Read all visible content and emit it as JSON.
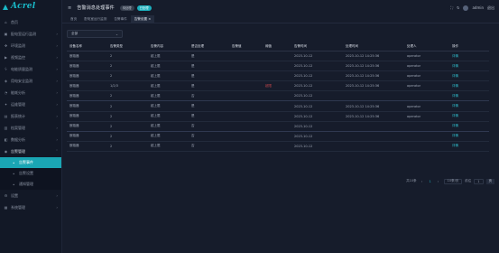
{
  "app": {
    "logo_text": "Acrel"
  },
  "sidebar": {
    "items": [
      {
        "label": "首页",
        "icon": "home-icon",
        "chevron": ""
      },
      {
        "label": "配电室运行监测",
        "icon": "monitor-icon",
        "chevron": "›"
      },
      {
        "label": "环境监测",
        "icon": "environment-icon",
        "chevron": "›"
      },
      {
        "label": "视频监控",
        "icon": "video-icon",
        "chevron": "›"
      },
      {
        "label": "电能质量监测",
        "icon": "power-quality-icon",
        "chevron": "›"
      },
      {
        "label": "用电安全监测",
        "icon": "shield-icon",
        "chevron": "›"
      },
      {
        "label": "能耗分析",
        "icon": "analysis-icon",
        "chevron": "›"
      },
      {
        "label": "运维管理",
        "icon": "maintenance-icon",
        "chevron": "›"
      },
      {
        "label": "报表统计",
        "icon": "report-icon",
        "chevron": "›"
      },
      {
        "label": "档案管理",
        "icon": "archive-icon",
        "chevron": "›"
      },
      {
        "label": "数据分析",
        "icon": "data-icon",
        "chevron": "›"
      },
      {
        "label": "告警管理",
        "icon": "alarm-icon",
        "chevron": "˄"
      }
    ],
    "sub_items": [
      {
        "label": "告警事件",
        "icon": "bell-icon",
        "active": true
      },
      {
        "label": "告警设置",
        "icon": "settings-icon",
        "active": false
      },
      {
        "label": "通知管理",
        "icon": "message-icon",
        "active": false
      }
    ],
    "bottom_items": [
      {
        "label": "设置",
        "icon": "gear-icon",
        "chevron": "›"
      },
      {
        "label": "系统管理",
        "icon": "system-icon",
        "chevron": "›"
      }
    ]
  },
  "topbar": {
    "menu_icon": "≡",
    "title": "告警消息处理事件",
    "badge_1": "待处理",
    "badge_2": "已处理",
    "right": {
      "fullscreen": "⛶",
      "refresh": "↻",
      "user": "admin",
      "logout": "退出"
    }
  },
  "tabs": [
    "首页",
    "配电室运行监测",
    "告警事件",
    "告警设置 ×"
  ],
  "filter": {
    "value": "全部",
    "chevron": "⌄"
  },
  "table": {
    "columns": [
      "设备名称",
      "告警类型",
      "告警内容",
      "是否处理",
      "告警值",
      "阈值",
      "告警时间",
      "处理时间",
      "处理人",
      "操作"
    ],
    "rows": [
      [
        "断路器",
        "2",
        "越上限",
        "是",
        "",
        "",
        "2023-10-12",
        "2023-10-12 14:25:36",
        "operator",
        "详情"
      ],
      [
        "断路器",
        "2",
        "越上限",
        "是",
        "",
        "",
        "2023-10-12",
        "2023-10-12 14:25:36",
        "operator",
        "详情"
      ],
      [
        "断路器",
        "2",
        "越上限",
        "是",
        "",
        "",
        "2023-10-12",
        "2023-10-12 14:25:36",
        "operator",
        "详情"
      ],
      [
        "断路器",
        "1/2/3",
        "越上限",
        "是",
        "",
        "超限",
        "2023-10-12",
        "2023-10-12 14:25:36",
        "operator",
        "详情"
      ],
      [
        "断路器",
        "2",
        "越上限",
        "否",
        "",
        "",
        "2023-10-12",
        "",
        "",
        "详情"
      ],
      [
        "断路器",
        "2",
        "越上限",
        "是",
        "",
        "",
        "2023-10-12",
        "2023-10-12 14:25:36",
        "operator",
        "详情"
      ],
      [
        "断路器",
        "2",
        "越上限",
        "是",
        "",
        "",
        "2023-10-12",
        "2023-10-12 14:25:36",
        "operator",
        "详情"
      ],
      [
        "断路器",
        "2",
        "越上限",
        "否",
        "",
        "",
        "2023-10-12",
        "",
        "",
        "详情"
      ],
      [
        "断路器",
        "2",
        "越上限",
        "否",
        "",
        "",
        "2023-10-12",
        "",
        "",
        "详情"
      ],
      [
        "断路器",
        "2",
        "越上限",
        "否",
        "",
        "",
        "2023-10-12",
        "",
        "",
        "详情"
      ]
    ],
    "group_ends": [
      4,
      7
    ]
  },
  "pagination": {
    "total": "共10条",
    "prev": "‹",
    "pages": [
      "1"
    ],
    "next": "›",
    "page_size": "10条/页",
    "goto_label": "前往",
    "goto_value": "1",
    "goto_unit": "页"
  }
}
